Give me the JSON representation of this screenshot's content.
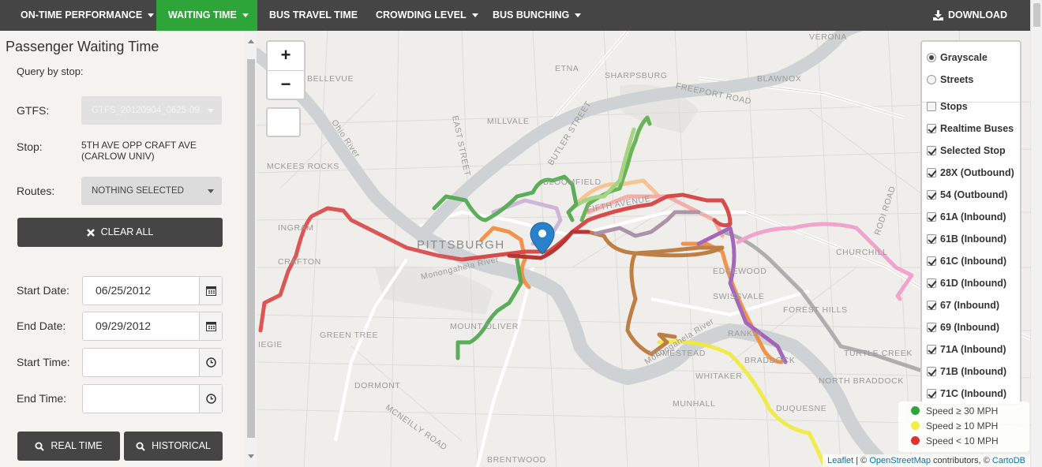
{
  "nav": {
    "items": [
      {
        "label": "ON-TIME PERFORMANCE",
        "dropdown": true,
        "active": false
      },
      {
        "label": "WAITING TIME",
        "dropdown": true,
        "active": true
      },
      {
        "label": "BUS TRAVEL TIME",
        "dropdown": false,
        "active": false
      },
      {
        "label": "CROWDING LEVEL",
        "dropdown": true,
        "active": false
      },
      {
        "label": "BUS BUNCHING",
        "dropdown": true,
        "active": false
      }
    ],
    "download_label": "DOWNLOAD",
    "download_icon": "download-icon",
    "colors": {
      "bar": "#454545",
      "active": "#2ea539"
    }
  },
  "panel": {
    "title": "Passenger Waiting Time",
    "query_label": "Query by stop:",
    "gtfs_label": "GTFS:",
    "gtfs_value": "GTFS_20120904_0625-09",
    "stop_label": "Stop:",
    "stop_value_line1": "5TH AVE OPP CRAFT AVE",
    "stop_value_line2": "(CARLOW UNIV)",
    "routes_label": "Routes:",
    "routes_value": "NOTHING SELECTED",
    "clear_all_label": "CLEAR ALL",
    "start_date_label": "Start Date:",
    "start_date_value": "06/25/2012",
    "end_date_label": "End Date:",
    "end_date_value": "09/29/2012",
    "start_time_label": "Start Time:",
    "start_time_value": "",
    "end_time_label": "End Time:",
    "end_time_value": "",
    "realtime_label": "REAL TIME",
    "historical_label": "HISTORICAL"
  },
  "map": {
    "zoom_in": "+",
    "zoom_out": "−",
    "labels": {
      "pittsburgh": "PITTSBURGH",
      "etna": "ETNA",
      "sharpsburg": "SHARPSBURG",
      "blawnox": "BLAWNOX",
      "verona": "VERONA",
      "bellevue": "BELLEVUE",
      "millvale": "MILLVALE",
      "freeport_road": "FREEPORT ROAD",
      "butler_street": "BUTLER STREET",
      "east_street": "EAST STREET",
      "mckees_rocks": "MCKEES ROCKS",
      "bloomfield": "BLOOMFIELD",
      "fifth_avenue": "FIFTH AVENUE",
      "ingram": "INGRAM",
      "crafton": "CRAFTON",
      "mt_oliver": "MOUNT OLIVER",
      "green_tree": "GREEN TREE",
      "edgewood": "EDGEWOOD",
      "swissvale": "SWISSVALE",
      "forest_hills": "FOREST HILLS",
      "churchill": "CHURCHILL",
      "rankin": "RANKIN",
      "braddock": "BRADDOCK",
      "north_braddock": "NORTH BRADDOCK",
      "turtle_creek": "TURTLE CREEK",
      "homestead": "HOMESTEAD",
      "whitaker": "WHITAKER",
      "munhall": "MUNHALL",
      "dormont": "DORMONT",
      "mcneilly_road": "MCNEILLY ROAD",
      "duquesne": "DUQUESNE",
      "brentwood": "BRENTWOOD",
      "carnegie": "IEGIE",
      "ohio_river": "Ohio River",
      "monongahela_1": "Monongahela River",
      "monongahela_2": "Monongahela River",
      "rodi_road": "RODI ROAD"
    },
    "layers": {
      "base": [
        {
          "label": "Grayscale",
          "checked": true
        },
        {
          "label": "Streets",
          "checked": false
        }
      ],
      "overlays": [
        {
          "label": "Stops",
          "checked": false
        },
        {
          "label": "Realtime Buses",
          "checked": true
        },
        {
          "label": "Selected Stop",
          "checked": true
        },
        {
          "label": "28X (Outbound)",
          "checked": true
        },
        {
          "label": "54 (Outbound)",
          "checked": true
        },
        {
          "label": "61A (Inbound)",
          "checked": true
        },
        {
          "label": "61B (Inbound)",
          "checked": true
        },
        {
          "label": "61C (Inbound)",
          "checked": true
        },
        {
          "label": "61D (Inbound)",
          "checked": true
        },
        {
          "label": "67 (Inbound)",
          "checked": true
        },
        {
          "label": "69 (Inbound)",
          "checked": true
        },
        {
          "label": "71A (Inbound)",
          "checked": true
        },
        {
          "label": "71B (Inbound)",
          "checked": true
        },
        {
          "label": "71C (Inbound)",
          "checked": true
        }
      ]
    },
    "legend": [
      {
        "label": "Speed ≥ 30 MPH",
        "color": "#2ea539"
      },
      {
        "label": "Speed ≥ 10 MPH",
        "color": "#f2ee44"
      },
      {
        "label": "Speed < 10 MPH",
        "color": "#e03131"
      }
    ],
    "attribution": {
      "leaflet": "Leaflet",
      "sep1": " | © ",
      "osm": "OpenStreetMap",
      "contrib": " contributors, © ",
      "carto": "CartoDB"
    },
    "routes": [
      {
        "name": "green-west",
        "color": "#4ca64c"
      },
      {
        "name": "green-south",
        "color": "#4ca64c"
      },
      {
        "name": "green-north",
        "color": "#5cae4a"
      },
      {
        "name": "red-west",
        "color": "#d94545"
      },
      {
        "name": "red-main",
        "color": "#d63a3a"
      },
      {
        "name": "dark-red",
        "color": "#b32020"
      },
      {
        "name": "brown",
        "color": "#b87333"
      },
      {
        "name": "orange",
        "color": "#f08a3c"
      },
      {
        "name": "purple",
        "color": "#9b59b6"
      },
      {
        "name": "gray",
        "color": "#a8a8a8"
      },
      {
        "name": "pink",
        "color": "#f29cc8"
      },
      {
        "name": "yellow",
        "color": "#f0eb3a"
      },
      {
        "name": "lavender",
        "color": "#cbb0d8"
      },
      {
        "name": "salmon",
        "color": "#f3a8a0"
      },
      {
        "name": "peach",
        "color": "#f6c08a"
      }
    ]
  }
}
